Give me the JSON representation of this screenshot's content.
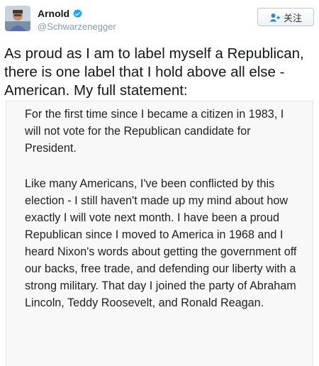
{
  "profile": {
    "display_name": "Arnold",
    "handle": "@Schwarzenegger",
    "verified_icon": "verified-badge-icon",
    "avatar_icon": "avatar-photo"
  },
  "follow_button": {
    "label": "关注",
    "icon": "add-user-icon"
  },
  "tweet": {
    "text": "As proud as I am to label myself a Republican, there is one label that I hold above all else - American. My full statement:"
  },
  "statement": {
    "paragraph_1": "For the first time since I became a citizen in 1983, I will not vote for the Republican candidate for President.",
    "paragraph_2": "Like many Americans, I've been conflicted by this election - I still haven't made up my mind about how exactly I will vote next month. I have been a proud Republican since I moved to America in 1968 and I heard Nixon's words about getting the government off our backs, free trade, and defending our liberty with a strong military. That day I joined the party of Abraham Lincoln, Teddy Roosevelt, and Ronald Reagan."
  },
  "colors": {
    "verified": "#1da1f2",
    "handle": "#8899a6",
    "statement_bg": "#f8f8f8"
  }
}
